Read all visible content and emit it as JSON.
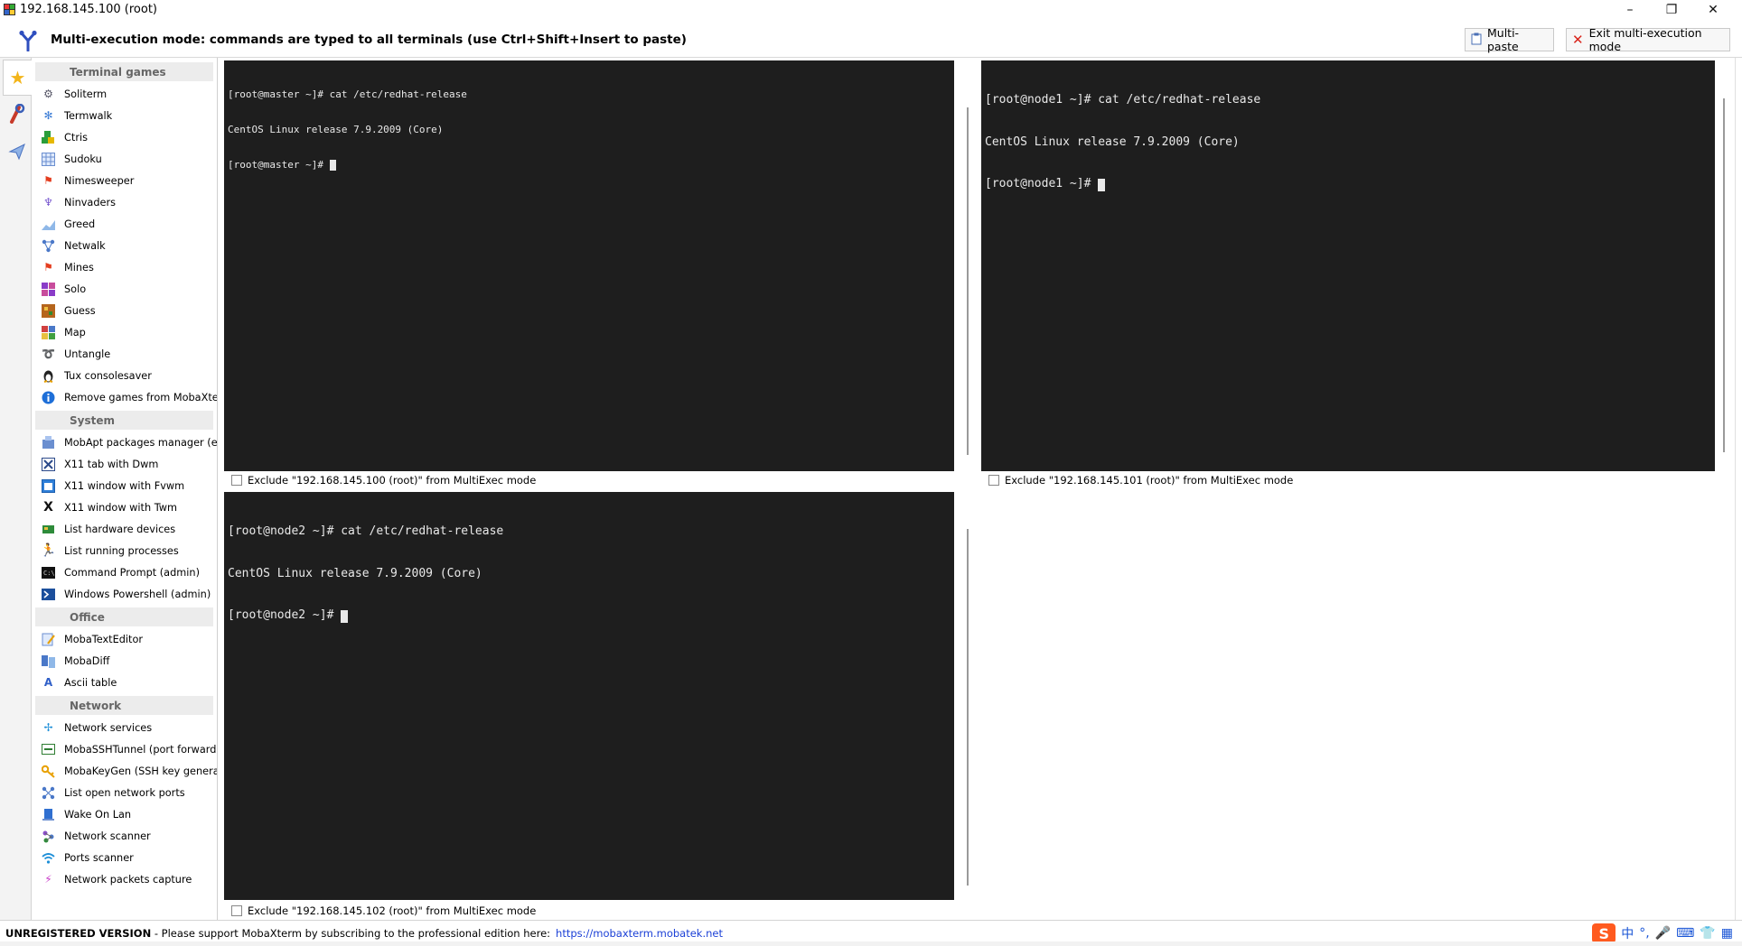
{
  "window": {
    "title": "192.168.145.100 (root)",
    "controls": {
      "minimize": "–",
      "maximize": "❐",
      "close": "✕"
    }
  },
  "multiexec": {
    "banner": "Multi-execution mode: commands are typed to all terminals (use Ctrl+Shift+Insert to paste)",
    "multipaste_label": "Multi-paste",
    "exit_label": "Exit multi-execution mode"
  },
  "sidebar": {
    "groups": [
      {
        "title": "Terminal games",
        "items": [
          {
            "label": "Soliterm",
            "icon": "gear-icon"
          },
          {
            "label": "Termwalk",
            "icon": "snowflake-icon"
          },
          {
            "label": "Ctris",
            "icon": "blocks-icon"
          },
          {
            "label": "Sudoku",
            "icon": "grid-icon"
          },
          {
            "label": "Nimesweeper",
            "icon": "flag-icon"
          },
          {
            "label": "Ninvaders",
            "icon": "invader-icon"
          },
          {
            "label": "Greed",
            "icon": "chart-icon"
          },
          {
            "label": "Netwalk",
            "icon": "network-icon"
          },
          {
            "label": "Mines",
            "icon": "flag-icon"
          },
          {
            "label": "Solo",
            "icon": "grid-color-icon"
          },
          {
            "label": "Guess",
            "icon": "puzzle-icon"
          },
          {
            "label": "Map",
            "icon": "map-icon"
          },
          {
            "label": "Untangle",
            "icon": "knot-icon"
          },
          {
            "label": "Tux consolesaver",
            "icon": "tux-icon"
          },
          {
            "label": "Remove games from MobaXterm",
            "icon": "info-icon"
          }
        ]
      },
      {
        "title": "System",
        "items": [
          {
            "label": "MobApt packages manager (exper",
            "icon": "package-icon"
          },
          {
            "label": "X11 tab with Dwm",
            "icon": "x11-icon"
          },
          {
            "label": "X11 window with Fvwm",
            "icon": "window-icon"
          },
          {
            "label": "X11 window with Twm",
            "icon": "x-icon"
          },
          {
            "label": "List hardware devices",
            "icon": "hardware-icon"
          },
          {
            "label": "List running processes",
            "icon": "runner-icon"
          },
          {
            "label": "Command Prompt (admin)",
            "icon": "cmd-icon"
          },
          {
            "label": "Windows Powershell (admin)",
            "icon": "powershell-icon"
          }
        ]
      },
      {
        "title": "Office",
        "items": [
          {
            "label": "MobaTextEditor",
            "icon": "pencil-icon"
          },
          {
            "label": "MobaDiff",
            "icon": "diff-icon"
          },
          {
            "label": "Ascii table",
            "icon": "ascii-icon"
          }
        ]
      },
      {
        "title": "Network",
        "items": [
          {
            "label": "Network services",
            "icon": "services-icon"
          },
          {
            "label": "MobaSSHTunnel (port forwarding)",
            "icon": "tunnel-icon"
          },
          {
            "label": "MobaKeyGen (SSH key generator)",
            "icon": "key-icon"
          },
          {
            "label": "List open network ports",
            "icon": "ports-icon"
          },
          {
            "label": "Wake On Lan",
            "icon": "wake-icon"
          },
          {
            "label": "Network scanner",
            "icon": "scanner-icon"
          },
          {
            "label": "Ports scanner",
            "icon": "wifi-icon"
          },
          {
            "label": "Network packets capture",
            "icon": "lightning-icon"
          }
        ]
      }
    ]
  },
  "terminals": {
    "master": {
      "lines": [
        "[root@master ~]# cat /etc/redhat-release",
        "CentOS Linux release 7.9.2009 (Core)",
        "[root@master ~]# "
      ],
      "exclude": "Exclude \"192.168.145.100 (root)\" from MultiExec mode"
    },
    "node1": {
      "lines": [
        "[root@node1 ~]# cat /etc/redhat-release",
        "CentOS Linux release 7.9.2009 (Core)",
        "[root@node1 ~]# "
      ],
      "exclude": "Exclude \"192.168.145.101 (root)\" from MultiExec mode"
    },
    "node2": {
      "lines": [
        "[root@node2 ~]# cat /etc/redhat-release",
        "CentOS Linux release 7.9.2009 (Core)",
        "[root@node2 ~]# "
      ],
      "exclude": "Exclude \"192.168.145.102 (root)\" from MultiExec mode"
    }
  },
  "status": {
    "unregistered": "UNREGISTERED VERSION",
    "message": " -  Please support MobaXterm by subscribing to the professional edition here:",
    "link": "https://mobaxterm.mobatek.net"
  },
  "ime": {
    "logo": "S",
    "lang": "中"
  },
  "colors": {
    "terminal_bg": "#1e1e1e",
    "terminal_fg": "#e9e9e9",
    "link": "#1a3fd6",
    "close_red": "#d9241b"
  }
}
